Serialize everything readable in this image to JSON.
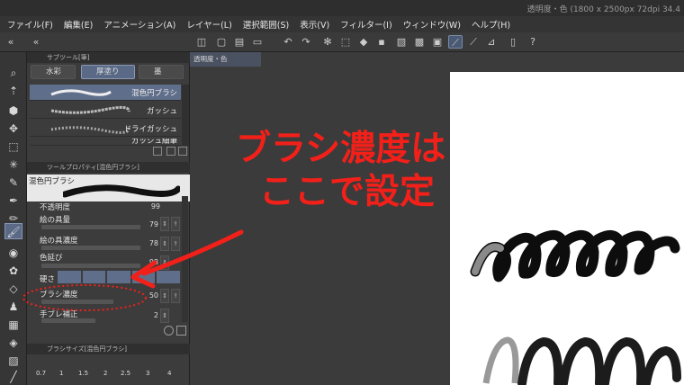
{
  "window": {
    "doc_title": "透明度・色 (1800 x 2500px 72dpi 34.4"
  },
  "menu": [
    "ファイル(F)",
    "編集(E)",
    "アニメーション(A)",
    "レイヤー(L)",
    "選択範囲(S)",
    "表示(V)",
    "フィルター(I)",
    "ウィンドウ(W)",
    "ヘルプ(H)"
  ],
  "subtool_panel": {
    "header": "サブツール[筆]",
    "tabs": [
      "水彩",
      "厚塗り",
      "墨"
    ],
    "brushes": [
      "混色円ブラシ",
      "ガッシュ",
      "ドライガッシュ",
      "ガッシュ細筆"
    ]
  },
  "tool_property": {
    "header": "ツールプロパティ[混色円ブラシ]",
    "brush_name": "混色円ブラシ",
    "props": [
      {
        "label": "不透明度",
        "value": "99"
      },
      {
        "label": "絵の具量",
        "value": "79"
      },
      {
        "label": "絵の具濃度",
        "value": "78"
      },
      {
        "label": "色延び",
        "value": "98"
      },
      {
        "label": "硬さ",
        "value": ""
      },
      {
        "label": "ブラシ濃度",
        "value": "50"
      },
      {
        "label": "手ブレ補正",
        "value": "2"
      }
    ]
  },
  "brush_size": {
    "header": "ブラシサイズ[混色円ブラシ]",
    "sizes": [
      "0.7",
      "1",
      "1.5",
      "2",
      "2.5",
      "3",
      "4"
    ]
  },
  "canvas": {
    "tab_label": "透明度・色"
  },
  "annotation": {
    "line1": "ブラシ濃度は",
    "line2": "ここで設定"
  }
}
